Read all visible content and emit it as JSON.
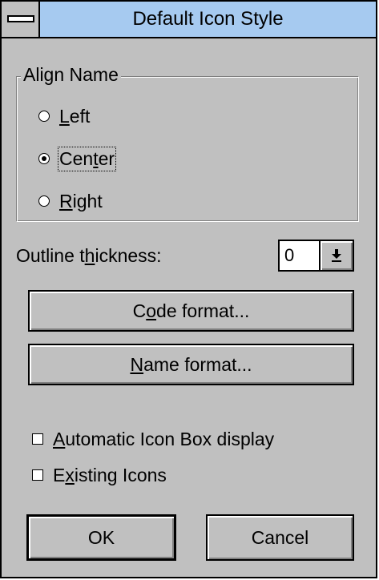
{
  "window": {
    "title": "Default Icon Style"
  },
  "align_name": {
    "label": "Align Name",
    "options": [
      {
        "pre": "",
        "key": "L",
        "post": "eft",
        "checked": false
      },
      {
        "pre": "Cen",
        "key": "t",
        "post": "er",
        "checked": true
      },
      {
        "pre": "",
        "key": "R",
        "post": "ight",
        "checked": false
      }
    ]
  },
  "outline": {
    "label_pre": "Outline t",
    "label_key": "h",
    "label_post": "ickness:",
    "value": "0"
  },
  "buttons": {
    "code_format": {
      "pre": "C",
      "key": "o",
      "post": "de format..."
    },
    "name_format": {
      "pre": "",
      "key": "N",
      "post": "ame format..."
    },
    "ok": "OK",
    "cancel": "Cancel"
  },
  "checks": [
    {
      "pre": "",
      "key": "A",
      "post": "utomatic Icon Box display",
      "checked": false
    },
    {
      "pre": "E",
      "key": "x",
      "post": "isting Icons",
      "checked": false
    }
  ]
}
